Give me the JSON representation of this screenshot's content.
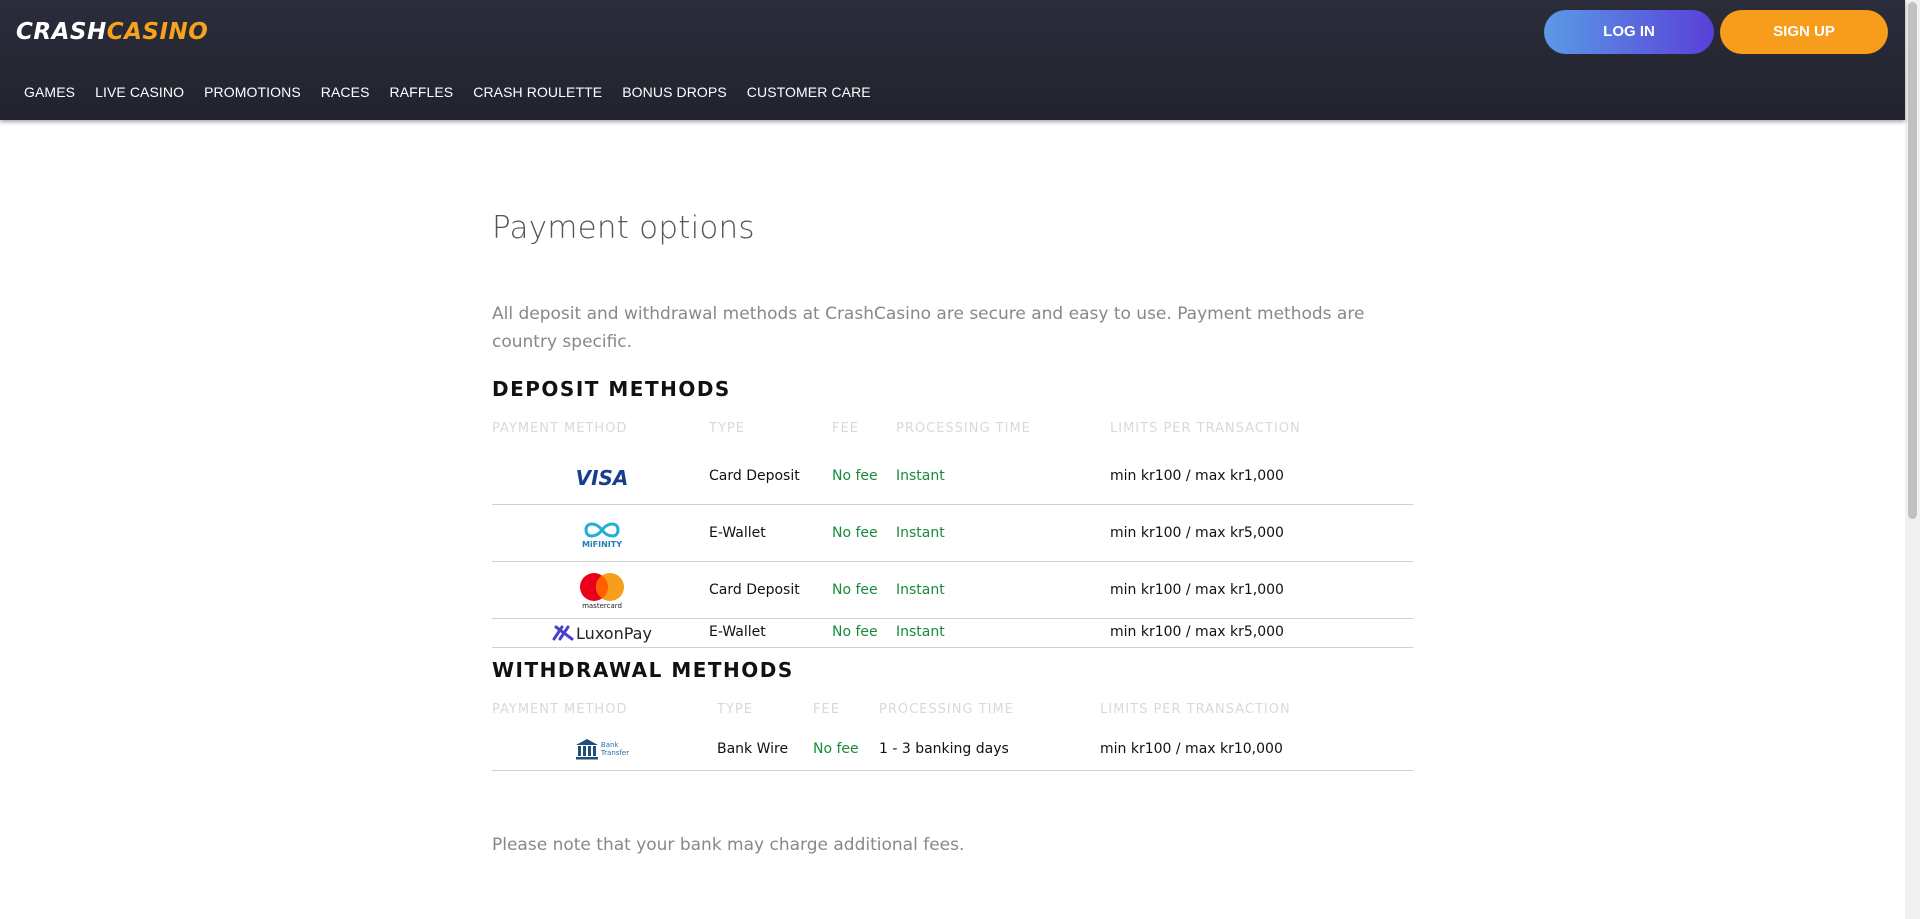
{
  "header": {
    "logo": {
      "part1": "CRASH",
      "part2": "CASINO"
    },
    "login_label": "LOG IN",
    "signup_label": "SIGN UP",
    "nav": [
      "GAMES",
      "LIVE CASINO",
      "PROMOTIONS",
      "RACES",
      "RAFFLES",
      "CRASH ROULETTE",
      "BONUS DROPS",
      "CUSTOMER CARE"
    ]
  },
  "page": {
    "title": "Payment options",
    "intro": "All deposit and withdrawal methods at CrashCasino are secure and easy to use. Payment methods are country specific.",
    "footnote": "Please note that your bank may charge additional fees."
  },
  "deposit": {
    "title": "DEPOSIT METHODS",
    "headers": [
      "PAYMENT METHOD",
      "TYPE",
      "FEE",
      "PROCESSING TIME",
      "LIMITS PER TRANSACTION"
    ],
    "rows": [
      {
        "method": "VISA",
        "type": "Card Deposit",
        "fee": "No fee",
        "time": "Instant",
        "limits": "min kr100 / max kr1,000"
      },
      {
        "method": "MiFINITY",
        "type": "E-Wallet",
        "fee": "No fee",
        "time": "Instant",
        "limits": "min kr100 / max kr5,000"
      },
      {
        "method": "mastercard",
        "type": "Card Deposit",
        "fee": "No fee",
        "time": "Instant",
        "limits": "min kr100 / max kr1,000"
      },
      {
        "method": "LuxonPay",
        "type": "E-Wallet",
        "fee": "No fee",
        "time": "Instant",
        "limits": "min kr100 / max kr5,000"
      }
    ]
  },
  "withdrawal": {
    "title": "WITHDRAWAL METHODS",
    "headers": [
      "PAYMENT METHOD",
      "TYPE",
      "FEE",
      "PROCESSING TIME",
      "LIMITS PER TRANSACTION"
    ],
    "rows": [
      {
        "method_line1": "Bank",
        "method_line2": "Transfer",
        "type": "Bank Wire",
        "fee": "No fee",
        "time": "1 - 3 banking days",
        "limits": "min kr100 / max kr10,000"
      }
    ]
  },
  "colors": {
    "accent_orange": "#f89c1c",
    "login_gradient_start": "#5a9be6",
    "login_gradient_end": "#5a3fd8",
    "fee_green": "#1a8a3a",
    "header_bg": "#262734"
  }
}
